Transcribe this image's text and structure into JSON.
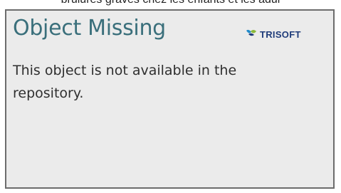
{
  "header_text": "brûlures graves chez les enfants et les adul",
  "panel": {
    "title": "Object Missing",
    "message": "This object is not available in the repository.",
    "logo": {
      "icon": "trisoft-logo-icon",
      "text": "TRISOFT"
    }
  },
  "colors": {
    "title": "#3a6f7b",
    "logo_text": "#1f3c7a",
    "panel_bg": "#ebebeb",
    "panel_border": "#6c6c6c"
  }
}
